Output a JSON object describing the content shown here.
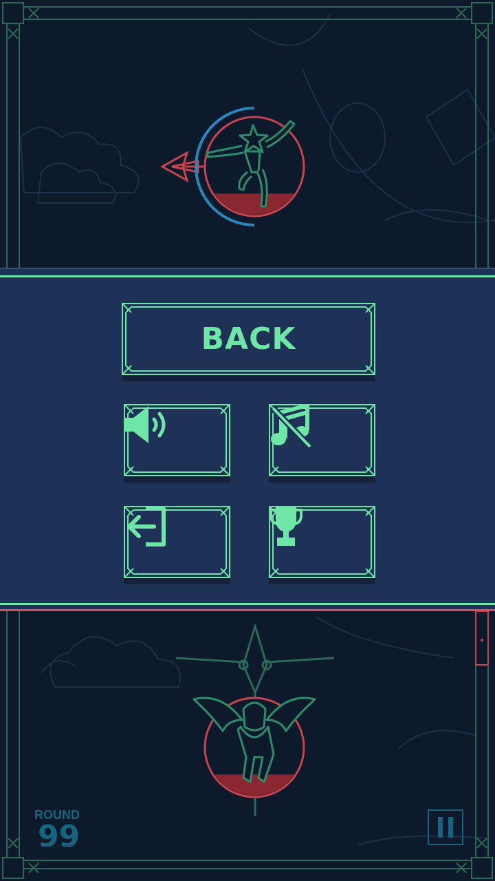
{
  "menu": {
    "back_label": "BACK",
    "buttons": [
      {
        "name": "sound-toggle",
        "icon": "speaker-icon"
      },
      {
        "name": "music-toggle",
        "icon": "music-muted-icon"
      },
      {
        "name": "exit",
        "icon": "exit-icon"
      },
      {
        "name": "leaderboard",
        "icon": "trophy-icon"
      }
    ]
  },
  "hud": {
    "round_label": "ROUND",
    "round_number": "99"
  },
  "characters": {
    "player": {
      "icon": "star-hero-icon",
      "health_fraction": 0.22
    },
    "enemy": {
      "icon": "gargoyle-icon",
      "health_fraction": 0.22
    }
  },
  "colors": {
    "accent": "#6ee6a6",
    "danger": "#e04b57",
    "panel": "#1e3157",
    "background": "#0d1a2c",
    "hud": "#16647f"
  }
}
